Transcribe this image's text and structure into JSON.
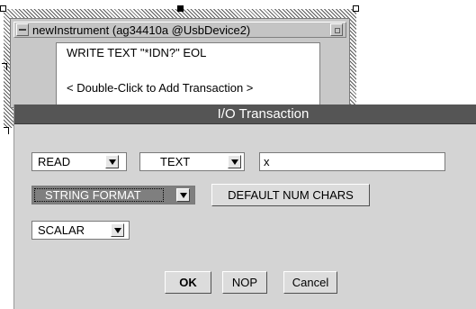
{
  "object": {
    "title": "newInstrument (ag34410a @UsbDevice2)",
    "transactions": [
      "WRITE TEXT \"*IDN?\" EOL",
      "< Double-Click to Add Transaction >"
    ]
  },
  "dialog": {
    "title": "I/O Transaction",
    "action_select": "READ",
    "encoding_select": "TEXT",
    "expression_value": "x",
    "format_select": "STRING FORMAT",
    "default_num_chars_label": "DEFAULT NUM CHARS",
    "type_select": "SCALAR",
    "ok_label": "OK",
    "nop_label": "NOP",
    "cancel_label": "Cancel"
  }
}
